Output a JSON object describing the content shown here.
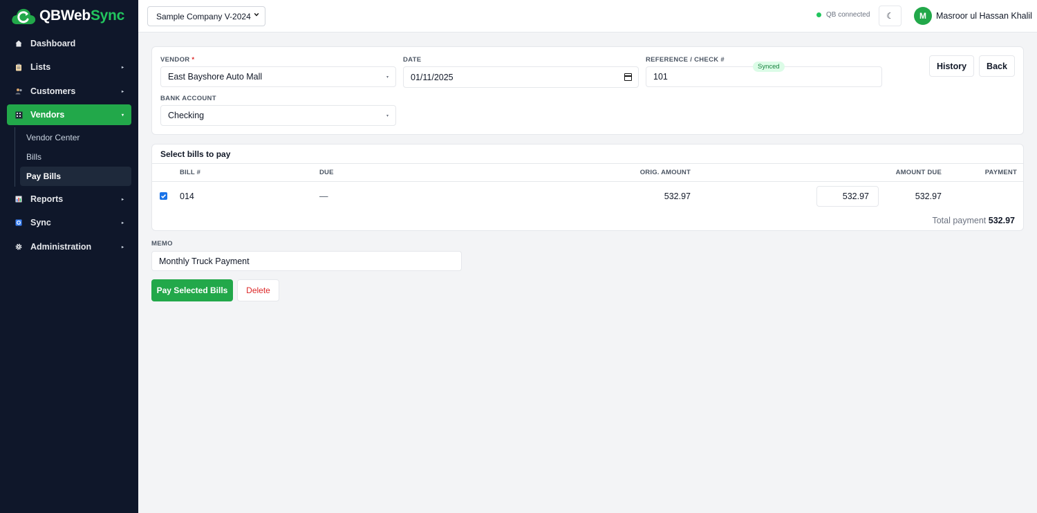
{
  "brand": {
    "name_part1": "QBWeb",
    "name_part2": "Sync"
  },
  "sidebar": {
    "items": [
      {
        "label": "Dashboard",
        "icon": "home-icon"
      },
      {
        "label": "Lists",
        "icon": "clipboard-icon"
      },
      {
        "label": "Customers",
        "icon": "users-icon"
      },
      {
        "label": "Vendors",
        "icon": "building-icon",
        "active": true
      },
      {
        "label": "Reports",
        "icon": "bar-chart-icon"
      },
      {
        "label": "Sync",
        "icon": "sync-icon"
      },
      {
        "label": "Administration",
        "icon": "gear-icon"
      }
    ],
    "vendor_subitems": [
      {
        "label": "Vendor Center"
      },
      {
        "label": "Bills"
      },
      {
        "label": "Pay Bills",
        "active": true
      }
    ]
  },
  "topbar": {
    "company": "Sample Company V-2024",
    "qb_status": "QB connected",
    "theme_icon": "☾",
    "user_initial": "M",
    "user_name": "Masroor ul Hassan Khalil"
  },
  "form": {
    "vendor_label": "VENDOR",
    "vendor_required": "*",
    "vendor_value": "East Bayshore Auto Mall",
    "date_label": "DATE",
    "date_value": "01/11/2025",
    "reference_label": "REFERENCE / CHECK #",
    "reference_value": "101",
    "bank_label": "BANK ACCOUNT",
    "bank_value": "Checking",
    "status_badge": "Synced",
    "history_label": "History",
    "back_label": "Back"
  },
  "bills": {
    "title": "Select bills to pay",
    "columns": {
      "bill": "BILL #",
      "due": "DUE",
      "orig": "ORIG. AMOUNT",
      "amount_due": "AMOUNT DUE",
      "payment": "PAYMENT"
    },
    "rows": [
      {
        "checked": true,
        "bill": "014",
        "due": "—",
        "orig": "532.97",
        "amount_due": "532.97",
        "payment": "532.97"
      }
    ],
    "total_label": "Total payment",
    "total_value": "532.97"
  },
  "memo": {
    "label": "MEMO",
    "value": "Monthly Truck Payment"
  },
  "actions": {
    "pay_label": "Pay Selected Bills",
    "delete_label": "Delete"
  },
  "colors": {
    "accent": "#22a84a",
    "sidebar_bg": "#0f172a",
    "danger": "#dc2626",
    "checkbox": "#1a73e8"
  }
}
